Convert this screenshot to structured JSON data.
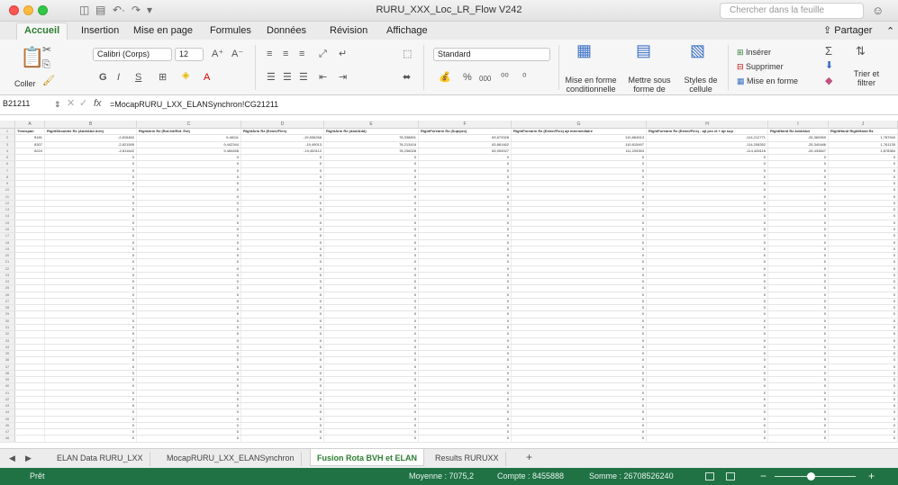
{
  "window": {
    "title": "RURU_XXX_Loc_LR_Flow V242",
    "search_placeholder": "Chercher dans la feuille"
  },
  "ribbon_tabs": [
    "Accueil",
    "Insertion",
    "Mise en page",
    "Formules",
    "Données",
    "Révision",
    "Affichage"
  ],
  "share_label": "Partager",
  "ribbon": {
    "paste": "Coller",
    "font_name": "Calibri (Corps)",
    "font_size": "12",
    "number_format": "Standard",
    "cond_format": [
      "Mise en forme",
      "conditionnelle"
    ],
    "format_table": [
      "Mettre sous",
      "forme de tableau"
    ],
    "cell_styles": [
      "Styles de",
      "cellule"
    ],
    "insert": "Insérer",
    "delete": "Supprimer",
    "format": "Mise en forme",
    "sort": [
      "Trier et",
      "filtrer"
    ]
  },
  "formula_bar": {
    "cell_ref": "B21211",
    "formula": "=MocapRURU_LXX_ELANSynchron!CG21211"
  },
  "grid": {
    "col_letters": [
      "A",
      "B",
      "C",
      "D",
      "E",
      "F",
      "G",
      "H",
      "I",
      "J"
    ],
    "headers": [
      "Timespan",
      "RightShoulder Rz (Add/Abd Arm)",
      "RightArm Rz (Rot.Int/Rot. Ext)",
      "RightArm Rz (Exten/Flex)",
      "RightArm Rz (Abd/Add)",
      "RightForearm Rz (Sup/pro)",
      "RightForearm Rz (Exten/Flex) ajt intermédiaire",
      "RightForearm Rz (Exten/Flex) - ajt pro et + ajt sup",
      "RightHand Rz Add/Abd",
      "RightHand RightHand Rz"
    ],
    "data_rows": [
      [
        "8181",
        "-2,816462",
        "9,48111",
        "-19,836268",
        "78,338891",
        "63,873328",
        "110,864513",
        "-114,212771",
        "-25,360959",
        "1,787940"
      ],
      [
        "8307",
        "-2,821595",
        "9,442344",
        "-19,49013",
        "78,213418",
        "63,861462",
        "110,815497",
        "-114,208352",
        "-25,340486",
        "1,761135"
      ],
      [
        "8224",
        "-2,811642",
        "9,484458",
        "-19,453112",
        "78,236028",
        "63,900027",
        "111,205353",
        "-114,428116",
        "-25,433847",
        "1,878384"
      ]
    ],
    "zero_value": "0",
    "empty_rows": 44
  },
  "sheet_tabs": [
    "ELAN Data RURU_LXX",
    "MocapRURU_LXX_ELANSynchron",
    "Fusion Rota BVH et ELAN",
    "Results RURUXX"
  ],
  "active_sheet": 2,
  "status": {
    "ready": "Prêt",
    "average": "Moyenne : 7075,2",
    "count": "Compte : 8455888",
    "sum": "Somme : 26708526240"
  }
}
